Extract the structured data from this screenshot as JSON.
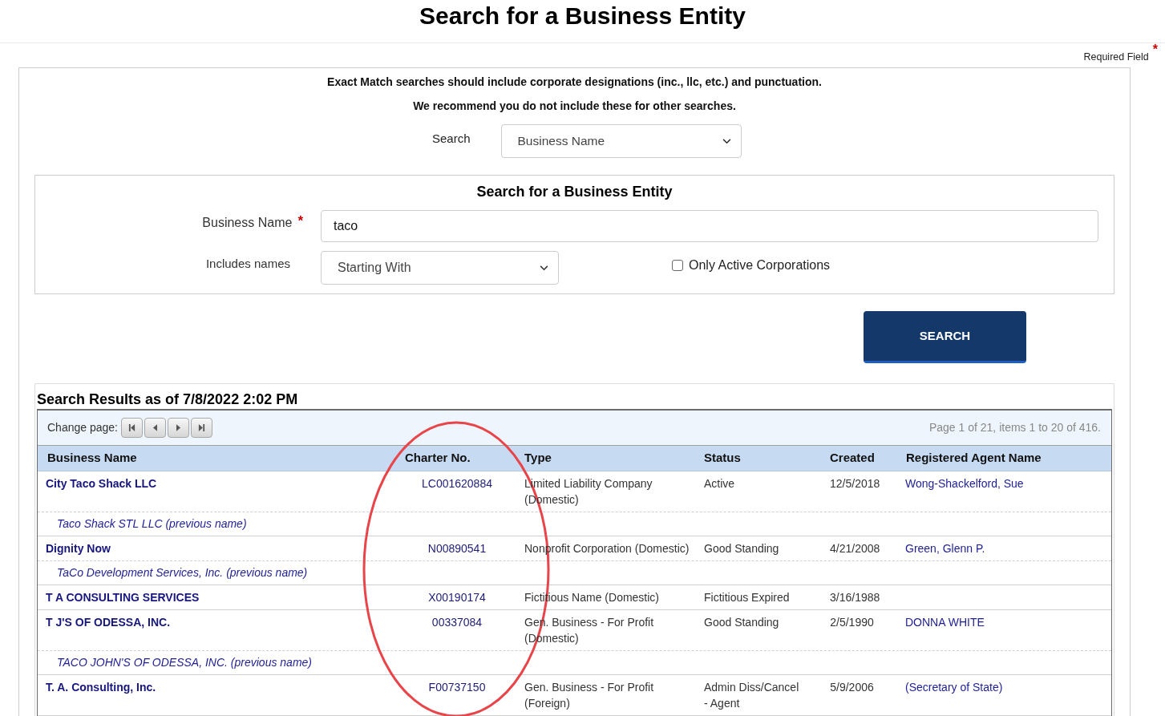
{
  "page": {
    "title": "Search for a Business Entity"
  },
  "required_note": {
    "label": "Required Field",
    "marker": "*"
  },
  "search_form": {
    "notes": [
      "Exact Match searches should include corporate designations (inc., llc, etc.) and punctuation.",
      "We recommend you do not include these for other searches."
    ],
    "search_by": {
      "label": "Search",
      "value": "Business Name"
    },
    "entity_panel": {
      "title": "Search for a Business Entity",
      "business_name": {
        "label": "Business Name",
        "required_marker": "*",
        "value": "taco"
      },
      "includes_names": {
        "label": "Includes names",
        "value": "Starting With"
      },
      "active_only": {
        "label": "Only Active Corporations",
        "checked": false
      }
    },
    "search_button": "SEARCH"
  },
  "results": {
    "title": "Search Results as of 7/8/2022 2:02 PM",
    "pager": {
      "label": "Change page:",
      "summary": "Page 1 of 21, items 1 to 20 of 416."
    },
    "table": {
      "columns": [
        "Business Name",
        "Charter No.",
        "Type",
        "Status",
        "Created",
        "Registered Agent Name"
      ],
      "rows": [
        {
          "business_name": "City Taco Shack LLC",
          "charter_no": "LC001620884",
          "type": "Limited Liability Company (Domestic)",
          "status": "Active",
          "created": "12/5/2018",
          "registered_agent": "Wong-Shackelford, Sue",
          "previous_name": "Taco Shack STL LLC (previous name)"
        },
        {
          "business_name": "Dignity Now",
          "charter_no": "N00890541",
          "type": "Nonprofit Corporation (Domestic)",
          "status": "Good Standing",
          "created": "4/21/2008",
          "registered_agent": "Green, Glenn P.",
          "previous_name": "TaCo Development Services, Inc. (previous name)"
        },
        {
          "business_name": "T A CONSULTING SERVICES",
          "charter_no": "X00190174",
          "type": "Fictitious Name (Domestic)",
          "status": "Fictitious Expired",
          "created": "3/16/1988"
        },
        {
          "business_name": "T J'S OF ODESSA, INC.",
          "charter_no": "00337084",
          "type": "Gen. Business - For Profit (Domestic)",
          "status": "Good Standing",
          "created": "2/5/1990",
          "registered_agent": "DONNA WHITE",
          "previous_name": "TACO JOHN'S OF ODESSA, INC. (previous name)"
        },
        {
          "business_name": "T. A. Consulting, Inc.",
          "charter_no": "F00737150",
          "type": "Gen. Business - For Profit (Foreign)",
          "status": "Admin Diss/Cancel - Agent",
          "created": "5/9/2006",
          "registered_agent": "(Secretary of State)"
        }
      ]
    }
  }
}
